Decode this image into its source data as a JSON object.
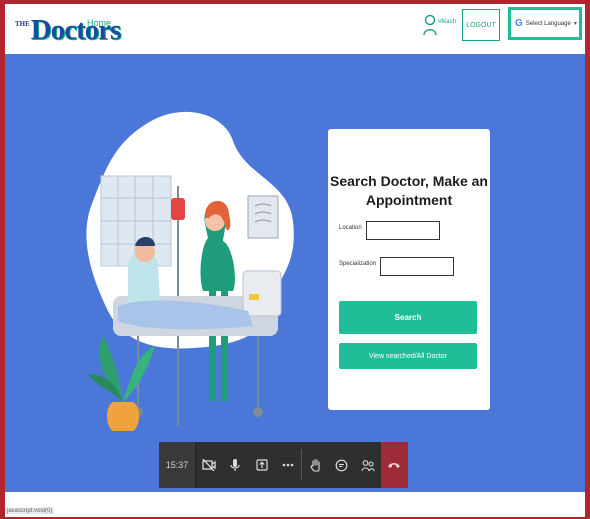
{
  "header": {
    "logo_prefix": "THE",
    "logo_text": "Doctors",
    "nav_home": "Home",
    "user_name": "Vikash",
    "logout_label": "LOGOUT",
    "language_label": "Select Language",
    "language_icon": "G"
  },
  "hero": {
    "card_title": "Search Doctor, Make an Appointment",
    "location_label": "Location",
    "location_value": "",
    "specialization_label": "Specialization",
    "specialization_value": "",
    "search_button": "Search",
    "view_all_button": "View searched/All Doctor"
  },
  "toolbar": {
    "time": "15:37",
    "icons": [
      "video-off-icon",
      "microphone-icon",
      "share-screen-icon",
      "more-icon",
      "raise-hand-icon",
      "chat-icon",
      "participants-icon",
      "end-call-icon"
    ]
  },
  "status": {
    "text": "javascript:void(0)"
  },
  "colors": {
    "hero_bg": "#4b78d8",
    "accent": "#1fbd98",
    "brand_blue": "#1e4a9c",
    "end_call": "#9e2b38"
  }
}
